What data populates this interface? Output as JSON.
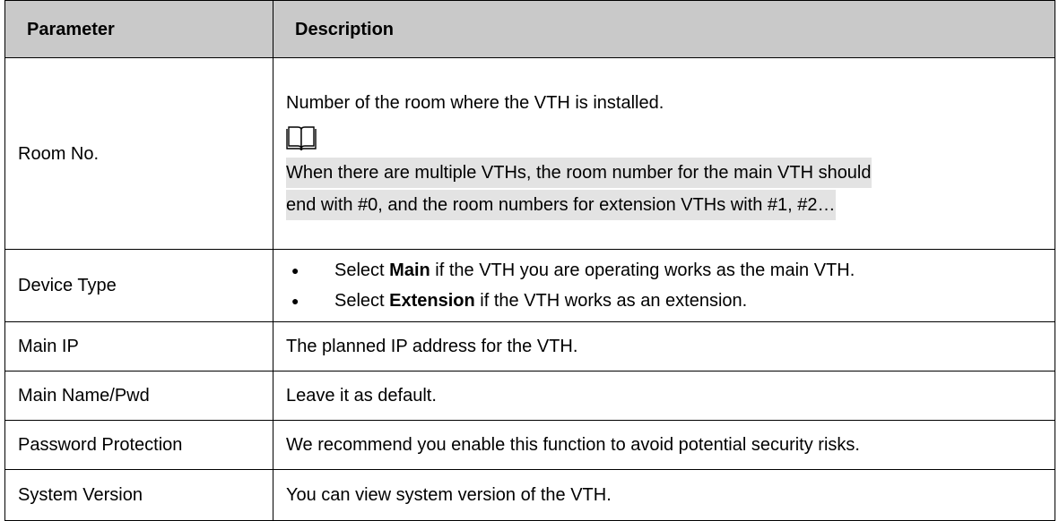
{
  "table": {
    "headers": {
      "parameter": "Parameter",
      "description": "Description"
    },
    "rows": {
      "room_no": {
        "param": "Room No.",
        "desc": "Number of the room where the VTH is installed.",
        "note_icon": "book-icon",
        "note_line1": "When there are multiple VTHs, the room number for the main VTH should",
        "note_line2": "end with #0, and the room numbers for extension VTHs with #1, #2…"
      },
      "device_type": {
        "param": "Device Type",
        "bullet1_prefix": "Select ",
        "bullet1_bold": "Main",
        "bullet1_suffix": " if the VTH you are operating works as the main VTH.",
        "bullet2_prefix": "Select ",
        "bullet2_bold": "Extension",
        "bullet2_suffix": " if the VTH works as an extension.",
        "bullet_glyph": "●"
      },
      "main_ip": {
        "param": "Main IP",
        "desc": "The planned IP address for the VTH."
      },
      "main_name_pwd": {
        "param": "Main Name/Pwd",
        "desc": "Leave it as default."
      },
      "password_protection": {
        "param": "Password Protection",
        "desc": "We recommend you enable this function to avoid potential security risks."
      },
      "system_version": {
        "param": "System Version",
        "desc": "You can view system version of the VTH."
      }
    }
  }
}
